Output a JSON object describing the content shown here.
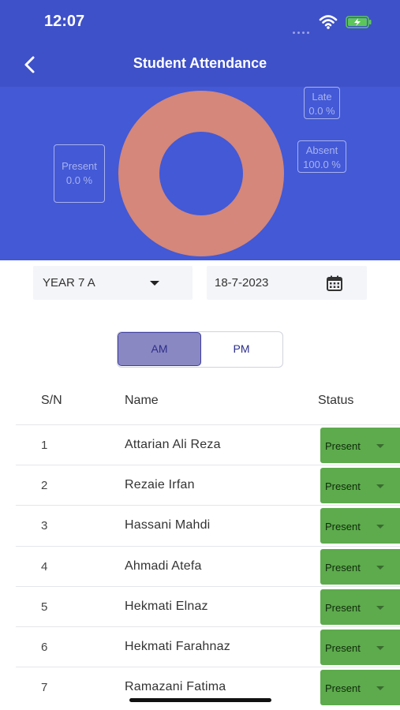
{
  "status_bar": {
    "time": "12:07"
  },
  "header": {
    "title": "Student Attendance"
  },
  "chart_data": {
    "type": "pie",
    "donut": true,
    "categories": [
      "Present",
      "Late",
      "Absent"
    ],
    "values": [
      0.0,
      0.0,
      100.0
    ],
    "labels": [
      "0.0 %",
      "0.0 %",
      "100.0 %"
    ],
    "colors": {
      "absent": "#d4877a",
      "background": "#4359d6",
      "legend": "#a9b2ee"
    }
  },
  "filters": {
    "class_value": "YEAR 7 A",
    "date_value": "18-7-2023"
  },
  "session_toggle": {
    "am_label": "AM",
    "pm_label": "PM",
    "selected": "AM"
  },
  "table": {
    "headers": {
      "sn": "S/N",
      "name": "Name",
      "status": "Status"
    },
    "rows": [
      {
        "sn": "1",
        "name": "Attarian Ali Reza",
        "status": "Present"
      },
      {
        "sn": "2",
        "name": "Rezaie Irfan",
        "status": "Present"
      },
      {
        "sn": "3",
        "name": "Hassani Mahdi",
        "status": "Present"
      },
      {
        "sn": "4",
        "name": "Ahmadi Atefa",
        "status": "Present"
      },
      {
        "sn": "5",
        "name": "Hekmati Elnaz",
        "status": "Present"
      },
      {
        "sn": "6",
        "name": "Hekmati Farahnaz",
        "status": "Present"
      },
      {
        "sn": "7",
        "name": "Ramazani Fatima",
        "status": "Present"
      }
    ]
  },
  "colors": {
    "primary": "#3f51c8",
    "present_green": "#5dab4c",
    "selected_toggle": "#8a88c3"
  }
}
